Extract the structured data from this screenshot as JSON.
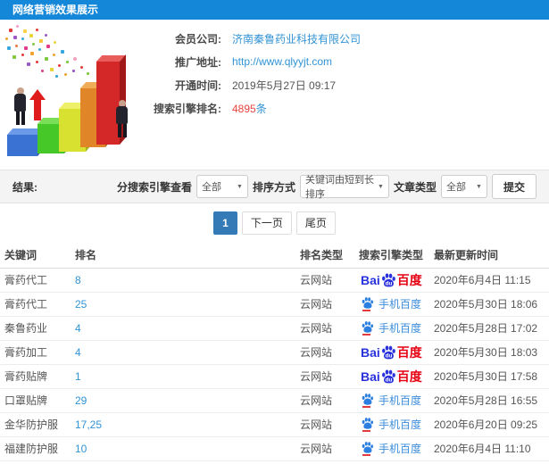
{
  "window": {
    "title": "网络营销效果展示"
  },
  "info": {
    "fields": [
      {
        "label": "会员公司:",
        "value": "济南秦鲁药业科技有限公司"
      },
      {
        "label": "推广地址:",
        "value": "http://www.qlyyjt.com"
      },
      {
        "label": "开通时间:",
        "value": "2019年5月27日 09:17"
      },
      {
        "label": "搜索引擎排名:",
        "count": "4895",
        "unit": "条"
      }
    ]
  },
  "filters": {
    "result_label": "结果:",
    "engine_label": "分搜索引擎查看",
    "engine_value": "全部",
    "sort_label": "排序方式",
    "sort_value": "关键词由短到长排序",
    "article_label": "文章类型",
    "article_value": "全部",
    "submit_label": "提交"
  },
  "pagination": {
    "current": "1",
    "next": "下一页",
    "last": "尾页"
  },
  "table": {
    "headers": [
      "关键词",
      "排名",
      "排名类型",
      "搜索引擎类型",
      "最新更新时间"
    ],
    "baidu_logo": {
      "bai": "Bai",
      "du": "du",
      "cn": "百度"
    },
    "mobile_baidu_label": "手机百度",
    "rows": [
      {
        "keyword": "膏药代工",
        "rank": "8",
        "rank_type": "云网站",
        "engine": "baidu",
        "time": "2020年6月4日 11:15"
      },
      {
        "keyword": "膏药代工",
        "rank": "25",
        "rank_type": "云网站",
        "engine": "mobile-baidu",
        "time": "2020年5月30日 18:06"
      },
      {
        "keyword": "秦鲁药业",
        "rank": "4",
        "rank_type": "云网站",
        "engine": "mobile-baidu",
        "time": "2020年5月28日 17:02"
      },
      {
        "keyword": "膏药加工",
        "rank": "4",
        "rank_type": "云网站",
        "engine": "baidu",
        "time": "2020年5月30日 18:03"
      },
      {
        "keyword": "膏药贴牌",
        "rank": "1",
        "rank_type": "云网站",
        "engine": "baidu",
        "time": "2020年5月30日 17:58"
      },
      {
        "keyword": "口罩贴牌",
        "rank": "29",
        "rank_type": "云网站",
        "engine": "mobile-baidu",
        "time": "2020年5月28日 16:55"
      },
      {
        "keyword": "金华防护服",
        "rank": "17,25",
        "rank_type": "云网站",
        "engine": "mobile-baidu",
        "time": "2020年6月20日 09:25"
      },
      {
        "keyword": "福建防护服",
        "rank": "10",
        "rank_type": "云网站",
        "engine": "mobile-baidu",
        "time": "2020年6月4日 11:10"
      }
    ]
  },
  "colors": {
    "header_bg": "#1487d8",
    "link_blue": "#3193d5",
    "highlight_red": "#e8413c",
    "active_page_bg": "#337ab7",
    "baidu_blue": "#2932dc",
    "baidu_red": "#e60012",
    "mobile_baidu_blue": "#3b8cdb"
  }
}
